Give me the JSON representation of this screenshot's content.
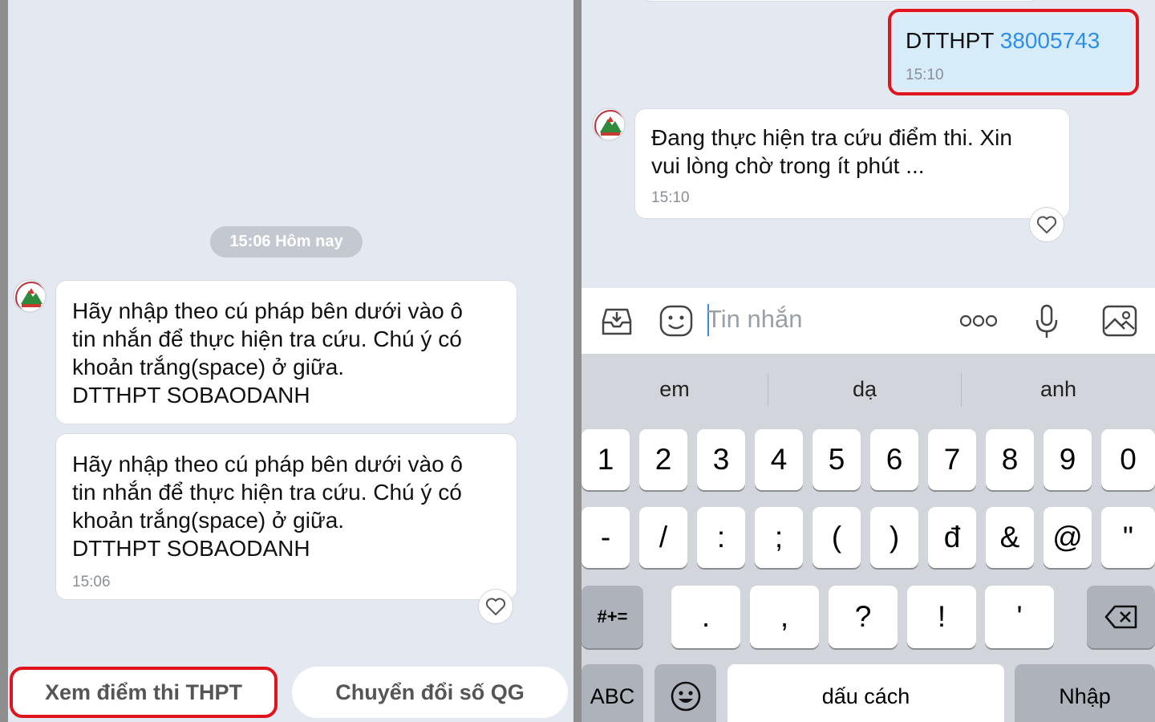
{
  "left": {
    "date_pill": "15:06 Hôm nay",
    "bubble1": {
      "text": "Hãy nhập theo cú pháp bên dưới vào ô\ntin nhắn để thực hiện tra cứu. Chú ý có\nkhoản trắng(space) ở giữa.\nDTTHPT SOBAODANH"
    },
    "bubble2": {
      "text": "Hãy nhập theo cú pháp bên dưới vào ô\ntin nhắn để thực hiện tra cứu. Chú ý có\nkhoản trắng(space) ở giữa.\nDTTHPT SOBAODANH",
      "time": "15:06"
    },
    "quick_replies": [
      "Xem điểm thi THPT",
      "Chuyển đổi số QG"
    ]
  },
  "right": {
    "sent": {
      "prefix": "DTTHPT ",
      "number": "38005743",
      "time": "15:10"
    },
    "reply": {
      "text": "Đang thực hiện tra cứu điểm thi. Xin\nvui lòng chờ trong ít phút ...",
      "time": "15:10"
    },
    "input": {
      "placeholder": "Tin nhắn"
    },
    "keyboard": {
      "suggestions": [
        "em",
        "dạ",
        "anh"
      ],
      "row1": [
        "1",
        "2",
        "3",
        "4",
        "5",
        "6",
        "7",
        "8",
        "9",
        "0"
      ],
      "row2": [
        "-",
        "/",
        ":",
        ";",
        "(",
        ")",
        "đ",
        "&",
        "@",
        "\""
      ],
      "row3_mode": "#+=",
      "row3": [
        ".",
        ",",
        "?",
        "!",
        "'"
      ],
      "abc": "ABC",
      "space": "dấu cách",
      "enter": "Nhập"
    }
  },
  "colors": {
    "highlight": "#e0141d",
    "link_blue": "#2f8ee8",
    "chat_bg": "#e4e8f1",
    "sent_bubble": "#d6ecf9"
  },
  "icons": [
    "logo-avatar",
    "heart-icon",
    "inbox-icon",
    "sticker-icon",
    "more-icon",
    "mic-icon",
    "image-icon",
    "backspace-icon",
    "emoji-icon"
  ]
}
